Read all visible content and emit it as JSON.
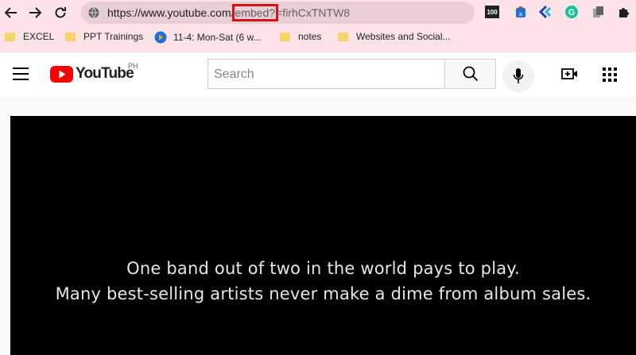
{
  "browser": {
    "url_host": "https://www.youtube.com",
    "url_highlight": "embed?",
    "url_rest": "=firhCxTNTW8",
    "url_slash": "/",
    "extension_badge": "100",
    "bookmarks": [
      {
        "label": "EXCEL",
        "icon": "folder-icon"
      },
      {
        "label": "PPT Trainings",
        "icon": "folder-icon"
      },
      {
        "label": "11-4: Mon-Sat (6 w...",
        "icon": "play-circle-icon"
      },
      {
        "label": "notes",
        "icon": "folder-icon"
      },
      {
        "label": "Websites and Social...",
        "icon": "folder-icon"
      }
    ],
    "highlight_color": "#d3131a"
  },
  "youtube": {
    "logo_text": "YouTube",
    "region": "PH",
    "search_placeholder": "Search",
    "brand_color": "#ff0000"
  },
  "video": {
    "caption_line1": "One band out of two in the world pays to play.",
    "caption_line2": "Many best-selling artists never make a dime from album sales."
  }
}
